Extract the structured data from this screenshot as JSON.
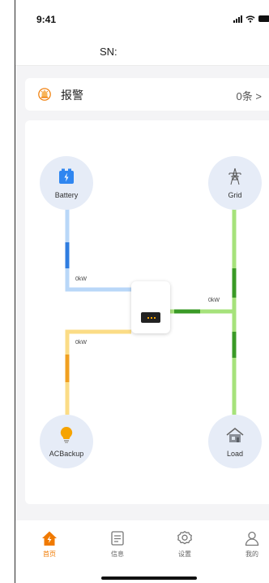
{
  "status_bar": {
    "time": "9:41"
  },
  "header": {
    "serial_label": "SN:"
  },
  "alarm": {
    "label": "报警",
    "count": "0条",
    "chevron": ">"
  },
  "flow": {
    "battery": {
      "label": "Battery",
      "power": "0kW"
    },
    "grid": {
      "label": "Grid",
      "power": "0kW"
    },
    "backup": {
      "label": "ACBackup",
      "power": "0kW"
    },
    "load": {
      "label": "Load"
    }
  },
  "tabs": [
    {
      "label": "首页",
      "icon": "home-icon",
      "active": true
    },
    {
      "label": "信息",
      "icon": "document-icon",
      "active": false
    },
    {
      "label": "设置",
      "icon": "gear-icon",
      "active": false
    },
    {
      "label": "我的",
      "icon": "person-icon",
      "active": false
    }
  ],
  "colors": {
    "accent": "#f07a00",
    "battery_line": "#b9d7f8",
    "battery_flow": "#2f7de0",
    "grid_line": "#a6e27b",
    "grid_flow": "#3a9a26",
    "backup_line": "#fbdc86",
    "backup_flow": "#f0a020",
    "node_bg": "#e6ecf7"
  }
}
